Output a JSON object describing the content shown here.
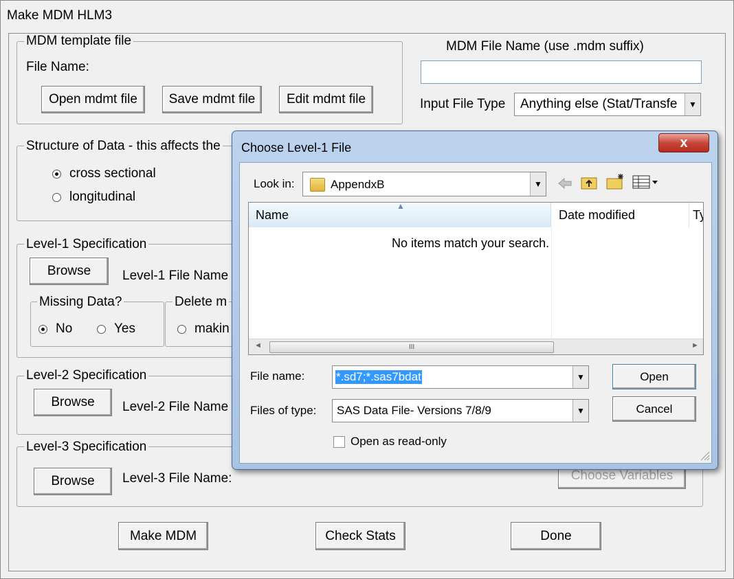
{
  "window": {
    "title": "Make MDM HLM3"
  },
  "mdm_template": {
    "legend": "MDM template file",
    "file_name_label": "File Name:",
    "open_button": "Open mdmt file",
    "save_button": "Save mdmt file",
    "edit_button": "Edit mdmt file"
  },
  "mdm_file": {
    "label": "MDM File Name (use .mdm suffix)",
    "value": "",
    "input_type_label": "Input File Type",
    "input_type_value": "Anything else (Stat/Transfe"
  },
  "structure": {
    "legend": "Structure of Data - this affects the",
    "options": [
      "cross sectional",
      "longitudinal"
    ],
    "selected": "cross sectional"
  },
  "level1": {
    "legend": "Level-1 Specification",
    "browse": "Browse",
    "file_name_label": "Level-1 File Name",
    "missing_legend": "Missing Data?",
    "missing_no": "No",
    "missing_yes": "Yes",
    "missing_selected": "No",
    "delete_legend": "Delete m",
    "delete_option": "makin"
  },
  "level2": {
    "legend": "Level-2 Specification",
    "browse": "Browse",
    "file_name_label": "Level-2 File Name"
  },
  "level3": {
    "legend": "Level-3 Specification",
    "browse": "Browse",
    "file_name_label": "Level-3 File Name:",
    "choose_variables": "Choose Variables"
  },
  "footer": {
    "make_mdm": "Make MDM",
    "check_stats": "Check Stats",
    "done": "Done"
  },
  "dialog": {
    "title": "Choose Level-1 File",
    "close_glyph": "x",
    "look_in_label": "Look in:",
    "look_in_value": "AppendxB",
    "columns": [
      "Name",
      "Date modified",
      "Ty"
    ],
    "empty_message": "No items match your search.",
    "scroll_grip": "III",
    "file_name_label": "File name:",
    "file_name_value": "*.sd7;*.sas7bdat",
    "files_of_type_label": "Files of type:",
    "files_of_type_value": "SAS Data File- Versions 7/8/9",
    "open_button": "Open",
    "cancel_button": "Cancel",
    "read_only_label": "Open as read-only",
    "read_only_checked": false
  }
}
